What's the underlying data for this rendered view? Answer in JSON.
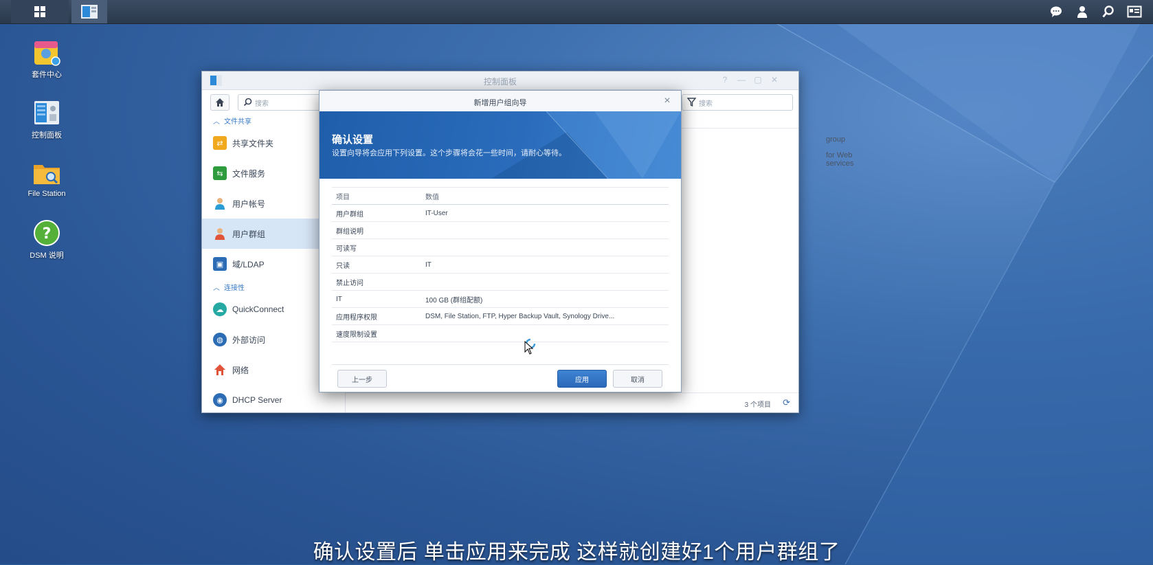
{
  "taskbar": {
    "main_menu_icon": "grid-icon",
    "active_app_icon": "control-panel-icon",
    "right_icons": [
      "chat-icon",
      "user-icon",
      "search-icon",
      "widgets-icon"
    ]
  },
  "desktop": {
    "icons": [
      {
        "label": "套件中心",
        "icon": "package-center-icon"
      },
      {
        "label": "控制面板",
        "icon": "control-panel-icon"
      },
      {
        "label": "File Station",
        "icon": "folder-search-icon"
      },
      {
        "label": "DSM 说明",
        "icon": "help-icon"
      }
    ]
  },
  "control_panel": {
    "title": "控制面板",
    "search_placeholder": "搜索",
    "filter_placeholder": "搜索",
    "sections": [
      {
        "label": "文件共享",
        "items": [
          "共享文件夹",
          "文件服务",
          "用户帐号",
          "用户群组",
          "域/LDAP"
        ]
      },
      {
        "label": "连接性",
        "items": [
          "QuickConnect",
          "外部访问",
          "网络",
          "DHCP Server"
        ]
      }
    ],
    "active_item": "用户群组",
    "list_rows": [
      "group",
      "for Web services"
    ],
    "footer_count": "3 个项目"
  },
  "wizard": {
    "title": "新增用户组向导",
    "heading": "确认设置",
    "description": "设置向导将会应用下列设置。这个步骤将会花一些时间，请耐心等待。",
    "table_header": {
      "item": "项目",
      "value": "数值"
    },
    "rows": [
      {
        "item": "用户群组",
        "value": "IT-User"
      },
      {
        "item": "群组说明",
        "value": ""
      },
      {
        "item": "可读写",
        "value": ""
      },
      {
        "item": "只读",
        "value": "IT"
      },
      {
        "item": "禁止访问",
        "value": ""
      },
      {
        "item": "IT",
        "value": "100 GB (群组配额)"
      },
      {
        "item": "应用程序权限",
        "value": "DSM, File Station, FTP, Hyper Backup Vault, Synology Drive..."
      },
      {
        "item": "速度限制设置",
        "value": ""
      }
    ],
    "buttons": {
      "prev": "上一步",
      "apply": "应用",
      "cancel": "取消"
    }
  },
  "subtitle": "确认设置后 单击应用来完成 这样就创建好1个用户群组了",
  "colors": {
    "accent": "#2a69b8",
    "desktop": "#2f5f9a",
    "sidebar_active": "#d7e6f7"
  }
}
